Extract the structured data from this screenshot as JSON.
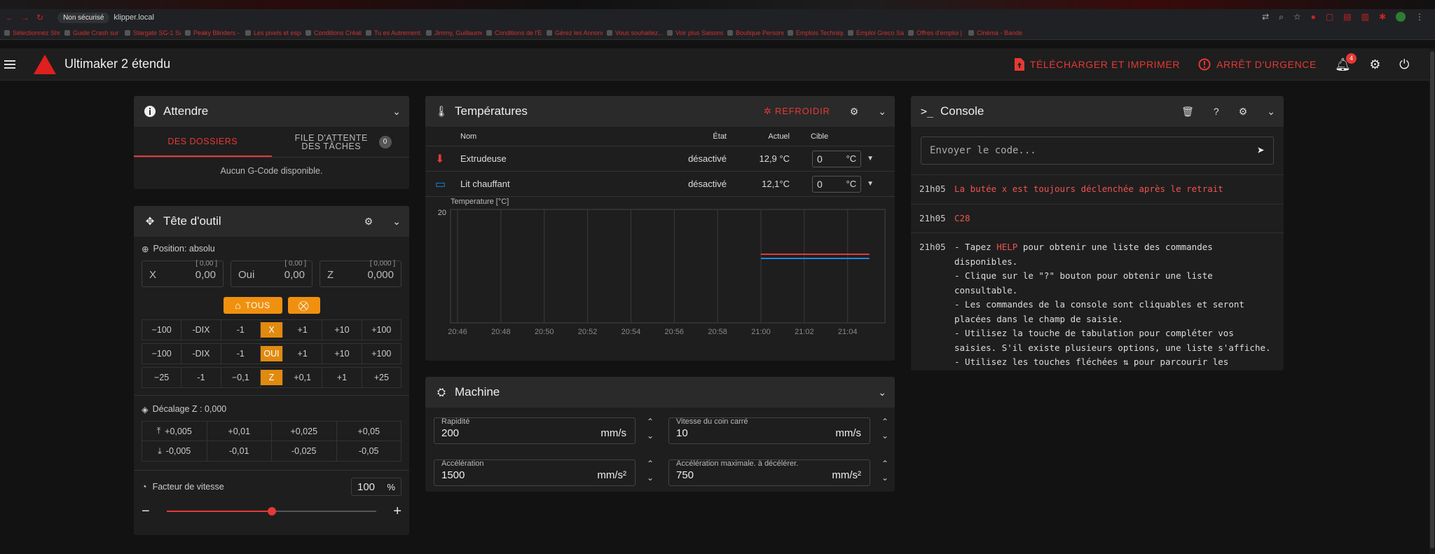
{
  "browser": {
    "secure_label": "Non sécurisé",
    "url": "klipper.local",
    "bookmarks": [
      "Sélectionnez Shr...",
      "Guide Crash sur la...",
      "Stargate SG-1 Saiso...",
      "Peaky Blinders - Sai...",
      "Les pixels et espaces...",
      "Conditions Créations...",
      "Tu es Autrement...",
      "Jimmy, Guillaume...",
      "Conditions de l'Entre...",
      "Gérez les Annonces...",
      "Vous souhaitez...",
      "Voir plus Saisons 4...",
      "Boutique Personnalis...",
      "Emplois Techniques...",
      "Emploi Greco Saturn...",
      "Offres d'emploi | Fa...",
      "Cinéma - Bande ann..."
    ]
  },
  "app": {
    "title": "Ultimaker 2 étendu",
    "upload_print": "TÉLÉCHARGER ET IMPRIMER",
    "emergency": "ARRÊT D'URGENCE",
    "notifications": "4"
  },
  "queue": {
    "title": "Attendre",
    "tab_files": "DES DOSSIERS",
    "tab_jobs": "FILE D'ATTENTE DES TÂCHES",
    "jobs_count": "0",
    "empty": "Aucun G-Code disponible."
  },
  "toolhead": {
    "title": "Tête d'outil",
    "position": "Position: absolu",
    "axes": [
      {
        "label": "X",
        "value": "0,00",
        "small": "[ 0,00 ]"
      },
      {
        "label": "Oui",
        "value": "0,00",
        "small": "[ 0,00 ]"
      },
      {
        "label": "Z",
        "value": "0,000",
        "small": "[ 0,000 ]"
      }
    ],
    "home_all": "TOUS",
    "jog_rows": [
      {
        "axis": "X",
        "steps": [
          "−100",
          "-DIX",
          "-1",
          "+1",
          "+10",
          "+100"
        ]
      },
      {
        "axis": "OUI",
        "steps": [
          "−100",
          "-DIX",
          "-1",
          "+1",
          "+10",
          "+100"
        ]
      },
      {
        "axis": "Z",
        "steps": [
          "−25",
          "-1",
          "−0,1",
          "+0,1",
          "+1",
          "+25"
        ]
      }
    ],
    "zoffset_label": "Décalage Z : 0,000",
    "zoffset_up": [
      "+0,005",
      "+0,01",
      "+0,025",
      "+0,05"
    ],
    "zoffset_down": [
      "-0,005",
      "-0,01",
      "-0,025",
      "-0,05"
    ],
    "speed_label": "Facteur de vitesse",
    "speed_value": "100",
    "speed_unit": "%",
    "speed_fraction": 0.5
  },
  "temps": {
    "title": "Températures",
    "cooldown": "REFROIDIR",
    "headers": {
      "name": "Nom",
      "state": "État",
      "actual": "Actuel",
      "target": "Cible"
    },
    "rows": [
      {
        "name": "Extrudeuse",
        "state": "désactivé",
        "actual": "12,9 °C",
        "target": "0",
        "unit": "°C",
        "color": "#e53935"
      },
      {
        "name": "Lit chauffant",
        "state": "désactivé",
        "actual": "12,1°C",
        "target": "0",
        "unit": "°C",
        "color": "#1e88e5"
      }
    ],
    "chart_data": {
      "type": "line",
      "ylabel": "Temperature [°C]",
      "y_tick": "20",
      "x_ticks": [
        "20:46",
        "20:48",
        "20:50",
        "20:52",
        "20:54",
        "20:56",
        "20:58",
        "21:00",
        "21:02",
        "21:04"
      ],
      "series": [
        {
          "color": "#e53935",
          "x": [
            "21:00",
            "21:05"
          ],
          "y": [
            12.9,
            12.9
          ]
        },
        {
          "color": "#1e88e5",
          "x": [
            "21:00",
            "21:05"
          ],
          "y": [
            12.1,
            12.1
          ]
        }
      ]
    }
  },
  "machine": {
    "title": "Machine",
    "fields": [
      {
        "label": "Rapidité",
        "value": "200",
        "unit": "mm/s"
      },
      {
        "label": "Vitesse du coin carré",
        "value": "10",
        "unit": "mm/s"
      },
      {
        "label": "Accélération",
        "value": "1500",
        "unit": "mm/s²"
      },
      {
        "label": "Accélération maximale. à décélérer.",
        "value": "750",
        "unit": "mm/s²"
      }
    ]
  },
  "console": {
    "title": "Console",
    "placeholder": "Envoyer le code...",
    "entries": [
      {
        "time": "21h05",
        "msg": "La butée x est toujours déclenchée après le retrait"
      },
      {
        "time": "21h05",
        "msg": "C28"
      }
    ],
    "help": {
      "time": "21h05",
      "line1_pre": "- Tapez ",
      "line1_kw": "HELP",
      "line1_post": " pour obtenir une liste des commandes disponibles.",
      "line2": "- Clique sur le \"?\" bouton pour obtenir une liste consultable.",
      "line3": "- Les commandes de la console sont cliquables et seront placées dans le champ de saisie.",
      "line4": "- Utilisez la touche de tabulation pour compléter vos saisies. S'il existe plusieurs options, une liste s'affiche.",
      "line5": "- Utilisez les touches fléchées ⇅ pour parcourir les"
    }
  }
}
